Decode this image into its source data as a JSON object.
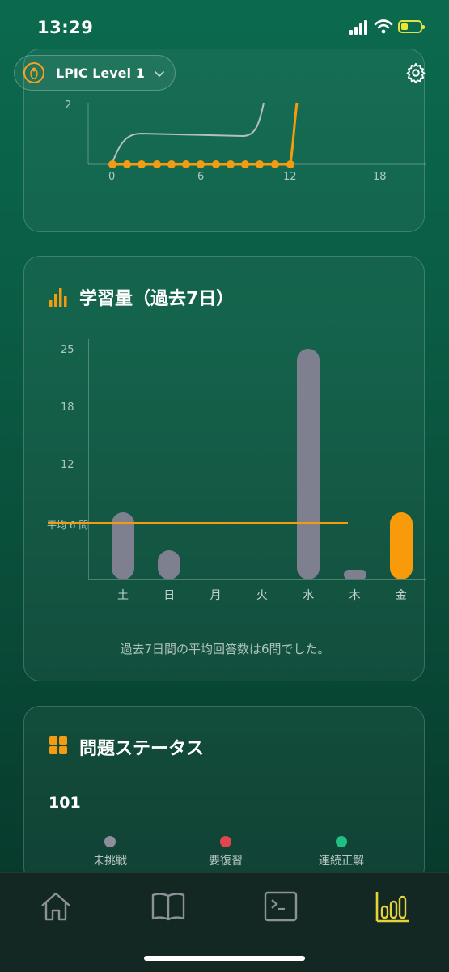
{
  "status": {
    "time": "13:29"
  },
  "header": {
    "course_name": "LPIC Level 1"
  },
  "top_chart": {
    "y_ticks": [
      "2"
    ],
    "x_ticks": [
      "0",
      "6",
      "12",
      "18"
    ]
  },
  "study_card": {
    "title": "学習量（過去7日）",
    "average_label": "平均 6 問",
    "caption": "過去7日間の平均回答数は6問でした。"
  },
  "chart_data": {
    "type": "bar",
    "title": "学習量（過去7日）",
    "categories": [
      "土",
      "日",
      "月",
      "火",
      "水",
      "木",
      "金"
    ],
    "values": [
      7,
      3,
      0,
      0,
      24,
      1,
      7
    ],
    "y_ticks": [
      "25",
      "18",
      "12"
    ],
    "ylim": [
      0,
      25
    ],
    "average": 6,
    "highlight_index": 6,
    "colors": {
      "bar": "#7e8090",
      "today": "#f99a0a",
      "average_line": "#f39c12"
    }
  },
  "status_card": {
    "title": "問題ステータス",
    "section": "101",
    "legend": [
      {
        "label": "未挑戦",
        "color": "#8c8e9c"
      },
      {
        "label": "要復習",
        "color": "#e0474c"
      },
      {
        "label": "連続正解",
        "color": "#1dbf84"
      }
    ]
  },
  "tabs": [
    {
      "icon": "home-icon"
    },
    {
      "icon": "book-icon"
    },
    {
      "icon": "terminal-icon"
    },
    {
      "icon": "stats-icon",
      "active": true
    }
  ]
}
